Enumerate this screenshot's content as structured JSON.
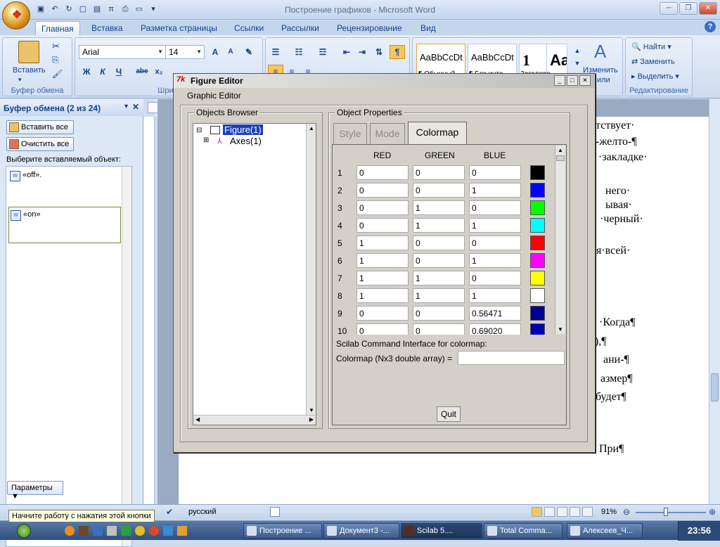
{
  "window": {
    "title": "Построение графиков - Microsoft Word"
  },
  "ribbon": {
    "tabs": [
      "Главная",
      "Вставка",
      "Разметка страницы",
      "Ссылки",
      "Рассылки",
      "Рецензирование",
      "Вид"
    ],
    "paste_label": "Вставить",
    "clipboard_group": "Буфер обмена",
    "font_group": "Шриф",
    "font_name": "Arial",
    "font_size": "14",
    "styles": [
      "AaBbCcDt",
      "AaBbCcDt",
      "1",
      "Aa"
    ],
    "style_names": [
      "¶ Обычный",
      "¶ Без инте...",
      "Заголово..."
    ],
    "change_styles": "Изменить",
    "change_styles2": "или",
    "find": "Найти",
    "replace": "Заменить",
    "select": "Выделить",
    "edit_group": "Редактирование"
  },
  "clipboard_pane": {
    "title": "Буфер обмена (2 из 24)",
    "paste_all": "Вставить все",
    "clear_all": "Очистить все",
    "hint": "Выберите вставляемый объект:",
    "items": [
      "«off».",
      "«on»"
    ],
    "params": "Параметры"
  },
  "document": {
    "lines": [
      "тствует·",
      "2.-желто-¶",
      "·закладке·",
      "него·",
      "ывая·",
      "·черный·",
      "ля·всей·",
      "·Когда¶",
      "ю),¶",
      "ани-¶",
      "азмер¶",
      "будет¶",
      "При¶"
    ]
  },
  "status": {
    "tooltip": "Начните работу с нажатия этой кнопки",
    "language": "русский",
    "zoom": "91%"
  },
  "taskbar": {
    "buttons": [
      "Построение ...",
      "Документ3 -...",
      "Scilab 5....",
      "Total Comma...",
      "Алексеев_Ч..."
    ],
    "clock": "23:56"
  },
  "figure_editor": {
    "title": "Figure Editor",
    "frame_label": "Graphic Editor",
    "browser_label": "Objects Browser",
    "props_label": "Object Properties",
    "tree": {
      "figure": "Figure(1)",
      "axes": "Axes(1)"
    },
    "tabs": [
      "Style",
      "Mode",
      "Colormap"
    ],
    "columns": [
      "RED",
      "GREEN",
      "BLUE"
    ],
    "rows": [
      {
        "n": "1",
        "r": "0",
        "g": "0",
        "b": "0",
        "color": "#000000"
      },
      {
        "n": "2",
        "r": "0",
        "g": "0",
        "b": "1",
        "color": "#0000ff"
      },
      {
        "n": "3",
        "r": "0",
        "g": "1",
        "b": "0",
        "color": "#00ff00"
      },
      {
        "n": "4",
        "r": "0",
        "g": "1",
        "b": "1",
        "color": "#00ffff"
      },
      {
        "n": "5",
        "r": "1",
        "g": "0",
        "b": "0",
        "color": "#ff0000"
      },
      {
        "n": "6",
        "r": "1",
        "g": "0",
        "b": "1",
        "color": "#ff00ff"
      },
      {
        "n": "7",
        "r": "1",
        "g": "1",
        "b": "0",
        "color": "#ffff00"
      },
      {
        "n": "8",
        "r": "1",
        "g": "1",
        "b": "1",
        "color": "#ffffff"
      },
      {
        "n": "9",
        "r": "0",
        "g": "0",
        "b": "0.56471",
        "color": "#000090"
      },
      {
        "n": "10",
        "r": "0",
        "g": "0",
        "b": "0.69020",
        "color": "#0000b0"
      }
    ],
    "cmd_label": "Scilab Command Interface for colormap:",
    "cmd_field": "Colormap (Nx3 double array) =",
    "quit": "Quit"
  }
}
